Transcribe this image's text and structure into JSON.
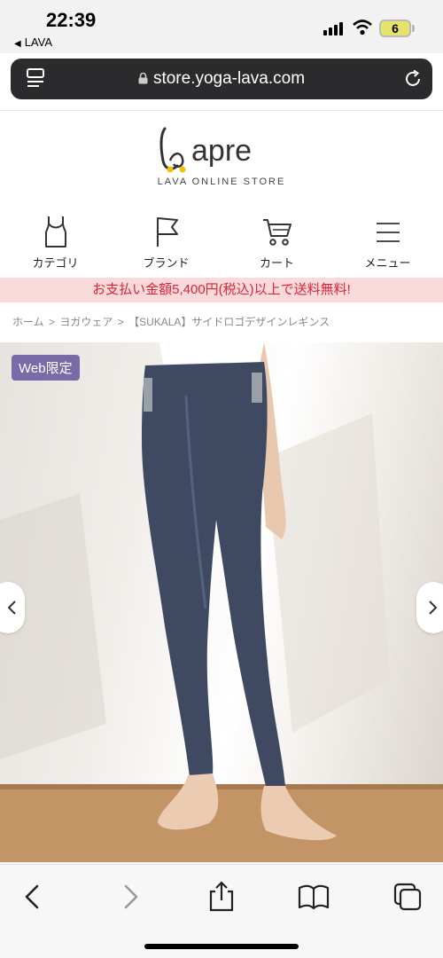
{
  "status_bar": {
    "time": "22:39",
    "back_app": "LAVA",
    "battery": "6"
  },
  "browser": {
    "url": "store.yoga-lava.com"
  },
  "brand": {
    "logo_word": "apre",
    "tagline": "LAVA ONLINE STORE"
  },
  "nav": [
    {
      "label": "カテゴリ",
      "icon": "tank-top-icon"
    },
    {
      "label": "ブランド",
      "icon": "flag-icon"
    },
    {
      "label": "カート",
      "icon": "cart-icon"
    },
    {
      "label": "メニュー",
      "icon": "menu-icon"
    }
  ],
  "promo": {
    "text": "お支払い金額5,400円(税込)以上で送料無料!",
    "color": "#d8253a"
  },
  "breadcrumb": {
    "home": "ホーム",
    "sep1": ">",
    "category": "ヨガウェア",
    "sep2": ">",
    "product": "【SUKALA】サイドロゴデザインレギンス"
  },
  "product": {
    "badge": "Web限定",
    "badge_color": "#7a6aa8"
  }
}
